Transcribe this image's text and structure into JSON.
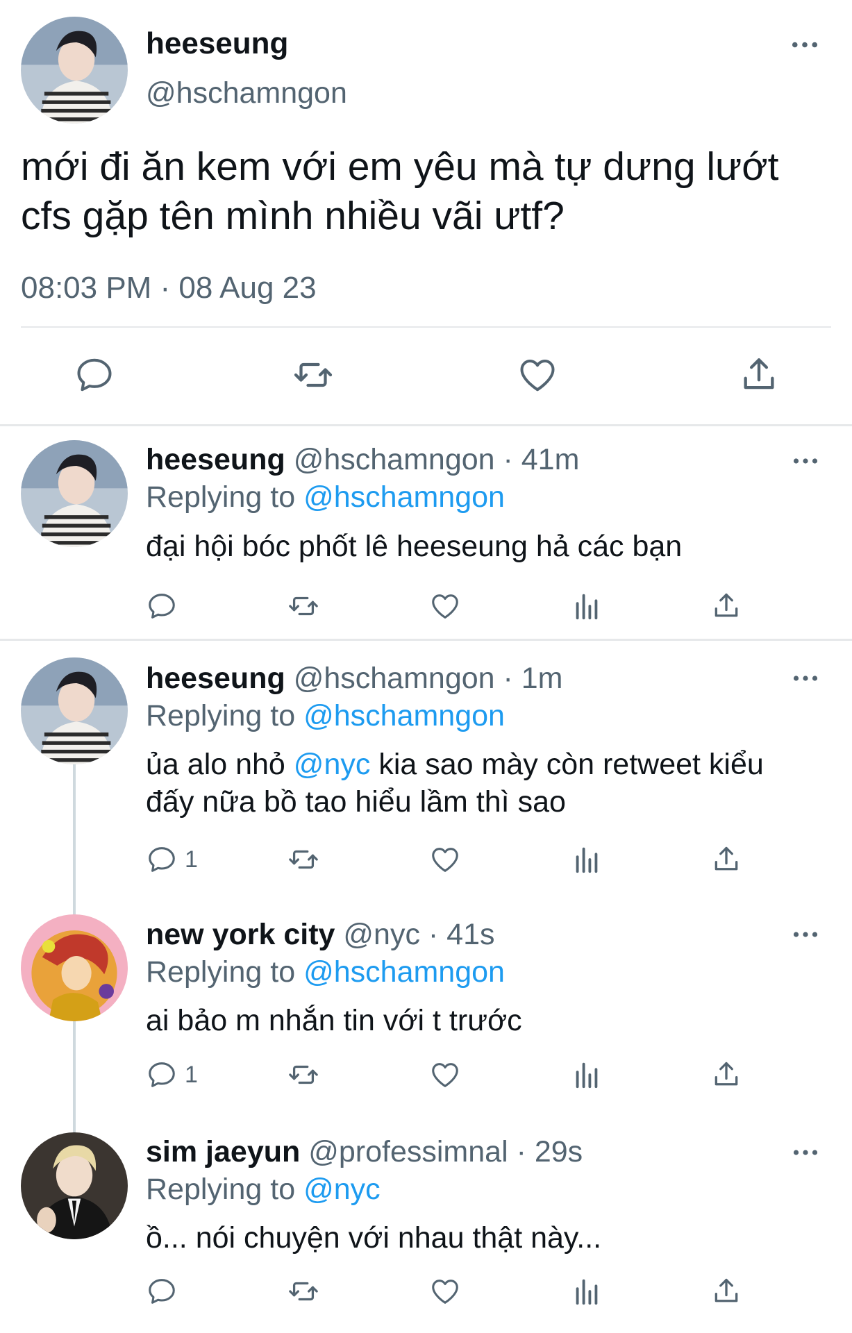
{
  "main": {
    "name": "heeseung",
    "handle": "@hschamngon",
    "text": "mới đi ăn kem với em yêu mà tự dưng lướt cfs gặp tên mình nhiều vãi ưtf?",
    "timestamp": "08:03 PM · 08 Aug 23",
    "actions": [
      "reply-icon",
      "retweet-icon",
      "like-icon",
      "share-icon"
    ]
  },
  "replies": [
    {
      "name": "heeseung",
      "meta": "@hschamngon · 41m",
      "replying_label": "Replying to",
      "replying_to": "@hschamngon",
      "text": "đại hội bóc phốt lê heeseung hả các bạn",
      "reply_count": ""
    },
    {
      "name": "heeseung",
      "meta": "@hschamngon · 1m",
      "replying_label": "Replying to",
      "replying_to": "@hschamngon",
      "text_before": "ủa alo nhỏ ",
      "mention": "@nyc",
      "text_after": " kia sao mày còn retweet kiểu đấy nữa bồ tao hiểu lầm thì sao",
      "reply_count": "1"
    },
    {
      "name": "new york city",
      "meta": "@nyc · 41s",
      "replying_label": "Replying to",
      "replying_to": "@hschamngon",
      "text": "ai bảo m nhắn tin với t trước",
      "reply_count": "1"
    },
    {
      "name": "sim jaeyun",
      "meta": "@professimnal · 29s",
      "replying_label": "Replying to",
      "replying_to": "@nyc",
      "text": "ồ... nói chuyện với nhau thật này...",
      "reply_count": ""
    }
  ],
  "colors": {
    "text": "#0f1419",
    "muted": "#536471",
    "link": "#1d9bf0",
    "divider": "#e6e8ea"
  }
}
